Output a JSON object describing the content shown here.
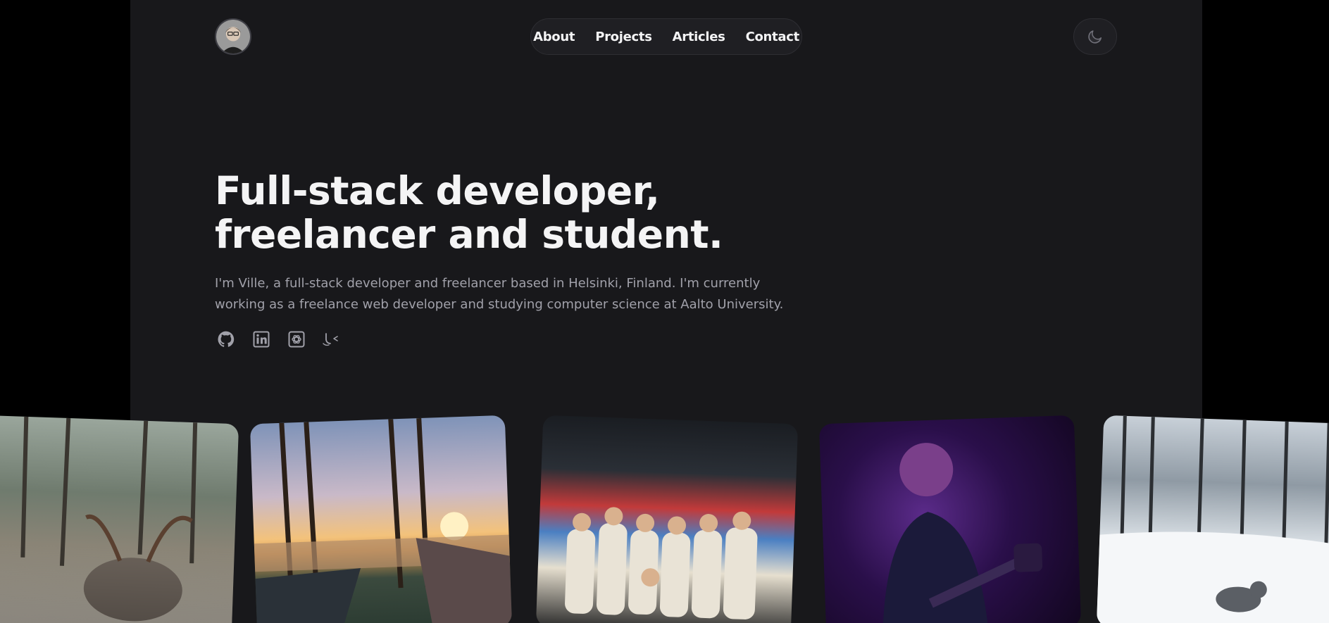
{
  "header": {
    "nav": [
      {
        "label": "About"
      },
      {
        "label": "Projects"
      },
      {
        "label": "Articles"
      },
      {
        "label": "Contact"
      }
    ],
    "theme_toggle_icon": "moon-icon"
  },
  "hero": {
    "title_line1": "Full-stack developer,",
    "title_line2": "freelancer and student.",
    "intro": "I'm Ville, a full-stack developer and freelancer based in Helsinki, Finland. I'm currently working as a freelance web developer and studying computer science at Aalto University."
  },
  "socials": [
    {
      "icon": "github-icon"
    },
    {
      "icon": "linkedin-icon"
    },
    {
      "icon": "openai-icon"
    },
    {
      "icon": "logo-mark-icon"
    }
  ],
  "photos": [
    {
      "icon": "reindeer-photo"
    },
    {
      "icon": "lake-sunset-photo"
    },
    {
      "icon": "group-photo"
    },
    {
      "icon": "guitarist-photo"
    },
    {
      "icon": "snowy-forest-dog-photo"
    }
  ],
  "colors": {
    "page_bg": "#000000",
    "panel_bg": "#18181b",
    "text_primary": "#f4f4f5",
    "text_secondary": "#a1a1aa"
  }
}
